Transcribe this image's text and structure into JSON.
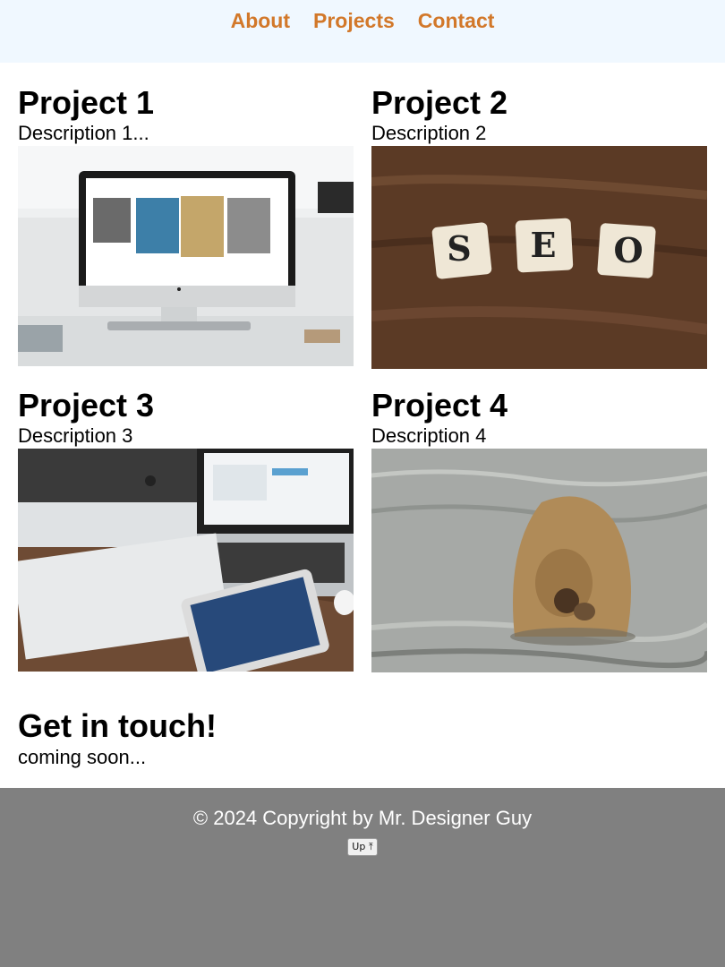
{
  "nav": {
    "items": [
      {
        "label": "About"
      },
      {
        "label": "Projects"
      },
      {
        "label": "Contact"
      }
    ],
    "color": "#d2782a",
    "background": "#f0f8ff"
  },
  "projects": [
    {
      "title": "Project 1",
      "description": "Description 1...",
      "image": "desktop-monitor-photo"
    },
    {
      "title": "Project 2",
      "description": "Description 2",
      "image": "seo-tiles-photo"
    },
    {
      "title": "Project 3",
      "description": "Description 3",
      "image": "devices-on-desk-photo"
    },
    {
      "title": "Project 4",
      "description": "Description 4",
      "image": "bear-in-water-photo"
    }
  ],
  "contact": {
    "heading": "Get in touch!",
    "text": "coming soon..."
  },
  "footer": {
    "copyright": "© 2024 Copyright by Mr. Designer Guy",
    "up_button": "Up ⤒",
    "background": "#808080"
  }
}
